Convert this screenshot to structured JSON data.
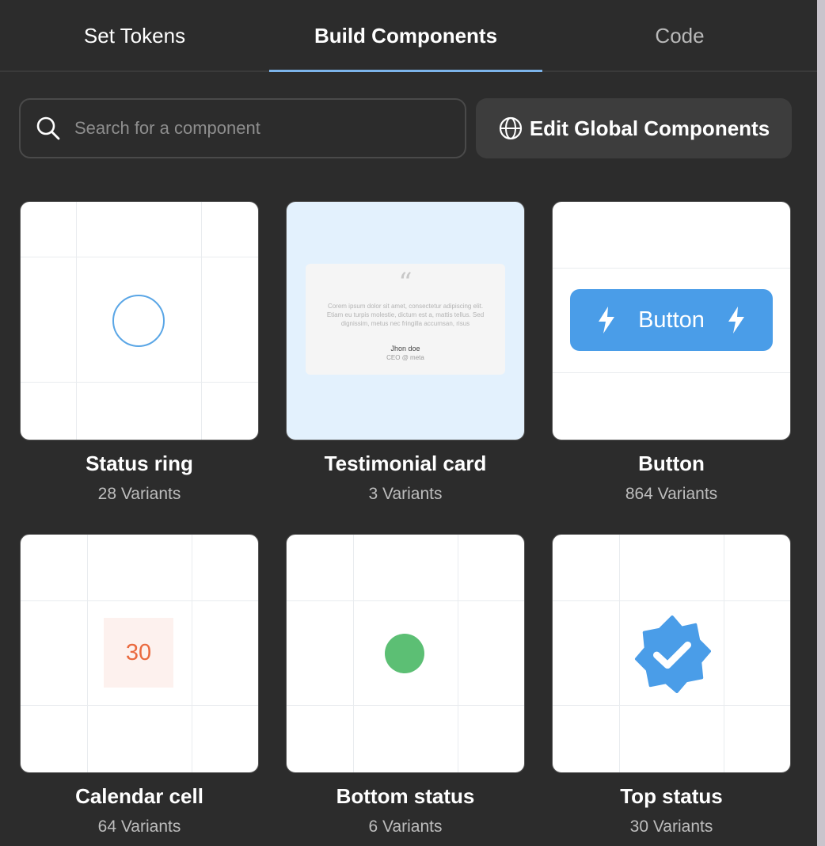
{
  "tabs": [
    {
      "label": "Set Tokens"
    },
    {
      "label": "Build Components"
    },
    {
      "label": "Code"
    }
  ],
  "active_tab": "Build Components",
  "search": {
    "placeholder": "Search for a component",
    "value": ""
  },
  "edit_global_label": "Edit Global Components",
  "components": [
    {
      "title": "Status ring",
      "variants": "28 Variants"
    },
    {
      "title": "Testimonial card",
      "variants": "3 Variants"
    },
    {
      "title": "Button",
      "variants": "864 Variants"
    },
    {
      "title": "Calendar cell",
      "variants": "64 Variants"
    },
    {
      "title": "Bottom status",
      "variants": "6 Variants"
    },
    {
      "title": "Top status",
      "variants": "30 Variants"
    }
  ],
  "previews": {
    "testimonial": {
      "quote_mark": "“",
      "text": "Corem ipsum dolor sit amet, consectetur adipiscing elit. Etiam eu turpis molestie, dictum est a, mattis tellus. Sed dignissim, metus nec fringilla accumsan, risus",
      "name": "Jhon doe",
      "role": "CEO @ meta"
    },
    "button_label": "Button",
    "calendar_day": "30"
  },
  "colors": {
    "background": "#2c2c2c",
    "accent_blue": "#4a9de8",
    "tab_underline": "#7cb4ea",
    "status_green": "#5cbf74",
    "calendar_orange": "#ea6a3f"
  },
  "icons": {
    "search": "search-icon",
    "globe": "globe-icon",
    "bolt": "lightning-bolt-icon",
    "verified": "verified-badge-icon"
  }
}
